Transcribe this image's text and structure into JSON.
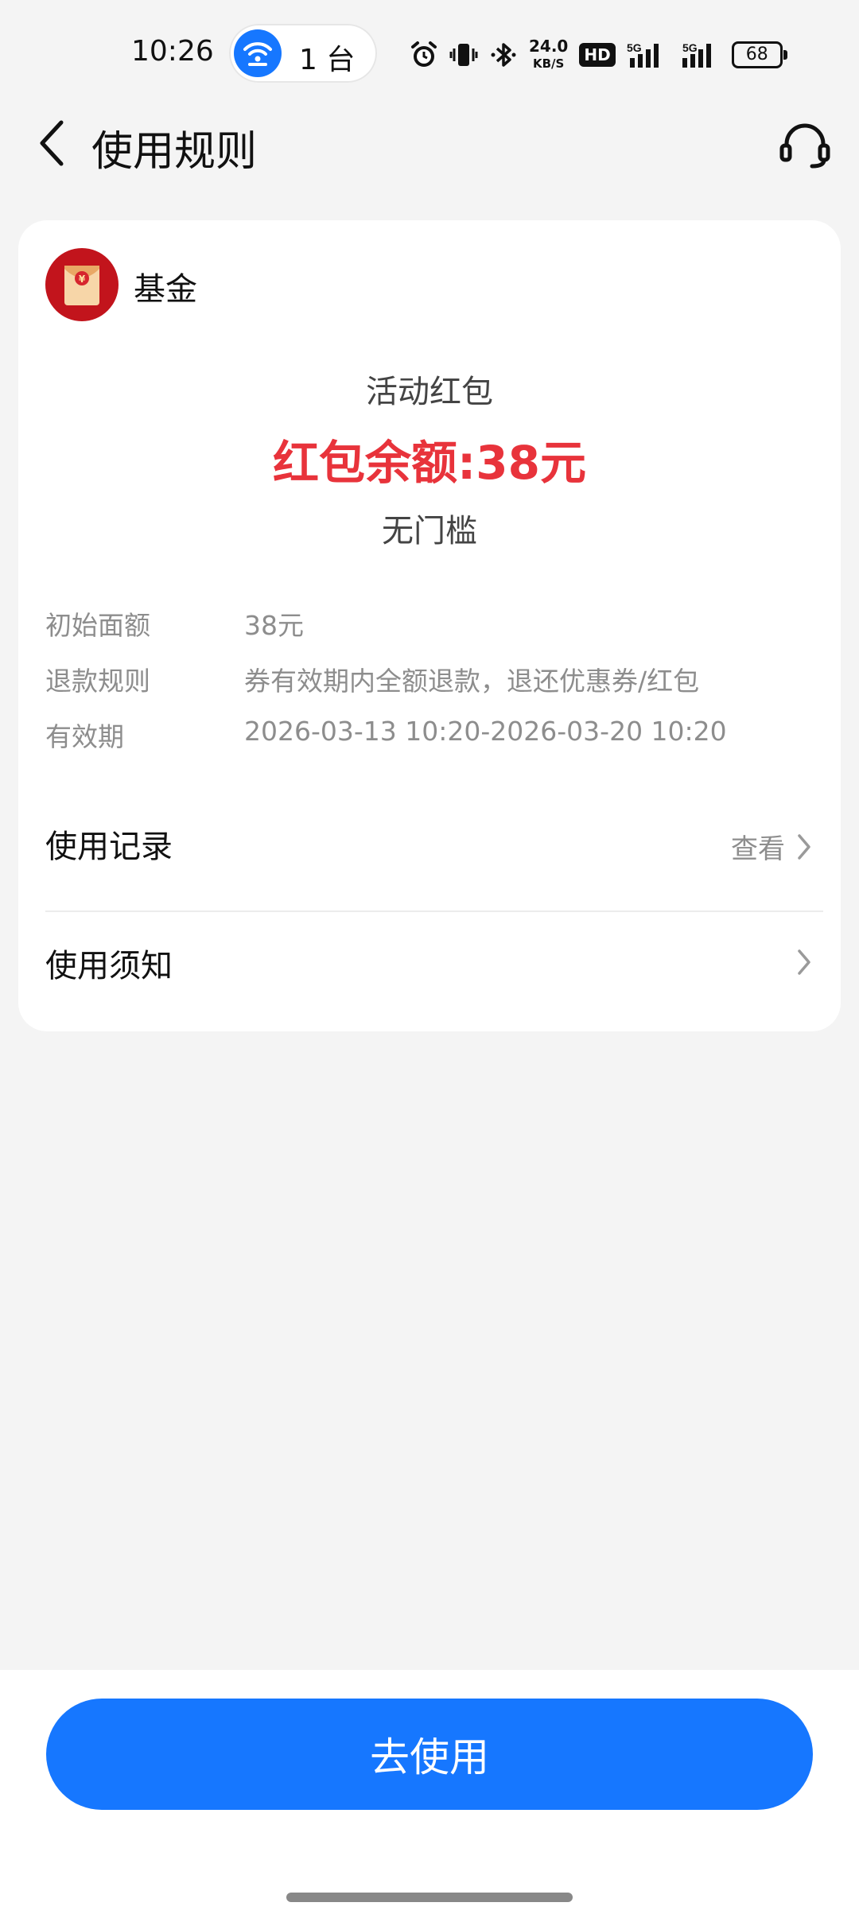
{
  "status_bar": {
    "time": "10:26",
    "hotspot_count": "1 台",
    "net_speed_value": "24.0",
    "net_speed_unit": "KB/S",
    "hd_label": "HD",
    "network_1": "5G",
    "network_2": "5G",
    "battery": "68"
  },
  "header": {
    "title": "使用规则"
  },
  "card": {
    "brand_name": "基金",
    "coupon_type": "活动红包",
    "balance": "红包余额:38元",
    "threshold": "无门槛",
    "details": [
      {
        "label": "初始面额",
        "value": "38元"
      },
      {
        "label": "退款规则",
        "value": "券有效期内全额退款，退还优惠券/红包"
      },
      {
        "label": "有效期",
        "value": "2026-03-13 10:20-2026-03-20 10:20"
      }
    ],
    "usage_record_label": "使用记录",
    "usage_record_view": "查看",
    "usage_notice_label": "使用须知"
  },
  "bottom": {
    "use_button_label": "去使用"
  },
  "colors": {
    "accent": "#1677ff",
    "balance_red": "#e8333b",
    "brand_red": "#c2141c"
  },
  "icons": {
    "back": "chevron-left-icon",
    "support": "headset-icon",
    "hotspot": "wifi-hotspot-icon",
    "brand": "red-envelope-icon",
    "row_arrow": "chevron-right-icon"
  }
}
